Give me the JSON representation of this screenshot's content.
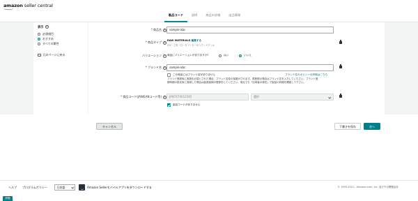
{
  "header": {
    "logo_bold": "amazon",
    "logo_light": " seller central",
    "tabs": [
      "製品コード",
      "説明",
      "商品の詳細",
      "出品情報"
    ]
  },
  "sidebar": {
    "title": "表示",
    "options": [
      "必須項目",
      "おすすめ",
      "すべての属性"
    ],
    "selected_index": 1,
    "link": "元のページに戻る"
  },
  "form": {
    "product_name": {
      "label": "商品名",
      "value": "sample-abc"
    },
    "product_type": {
      "label": "商品タイプ",
      "value": "RAW MATERIALS",
      "edit_link": "編集する",
      "path": "DIY・工具 › ロータリーカーボンウッドデッキ"
    },
    "variation": {
      "label": "バリエーション",
      "question": "商品にバリエーションがありますか?",
      "options": [
        "はい",
        "いいえ"
      ],
      "selected_index": 1
    },
    "brand": {
      "label": "ブランド名",
      "value": "sample-abc",
      "no_brand": "この商品にはブランド名がありません",
      "policy_link": "ブランド名のポリシーの詳細はこちら",
      "help": [
        "ブランド登録後に実施を必須とされた場合、ブランド名前の保護がされます。再登録の場合はブランド名を入力してください。ブランド登",
        "録時期の設定後に適用した場合は製造者側の登録をしてください。他社でも「出荷者の責任」で製品の詳細を確認して下さい。"
      ]
    },
    "product_id": {
      "label": "商品コード(JAN/EANコード等)",
      "value_placeholder": "JAN7474012345",
      "type_placeholder": "選択",
      "no_code": "製品コードがありません"
    }
  },
  "buttons": {
    "cancel": "キャンセル",
    "save_draft": "下書きを保存",
    "next": "次へ"
  },
  "footer": {
    "help": "ヘルプ",
    "policy": "プログラムポリシー",
    "language": "日本語",
    "app": "Amazon Sellerモバイルアプリをダウンロードする",
    "copyright": "© 1999-2021、Amazon.com, Inc. 及びその関連会社",
    "feedback": "評価"
  },
  "colors": {
    "accent": "#00808a",
    "required": "#c40000"
  }
}
